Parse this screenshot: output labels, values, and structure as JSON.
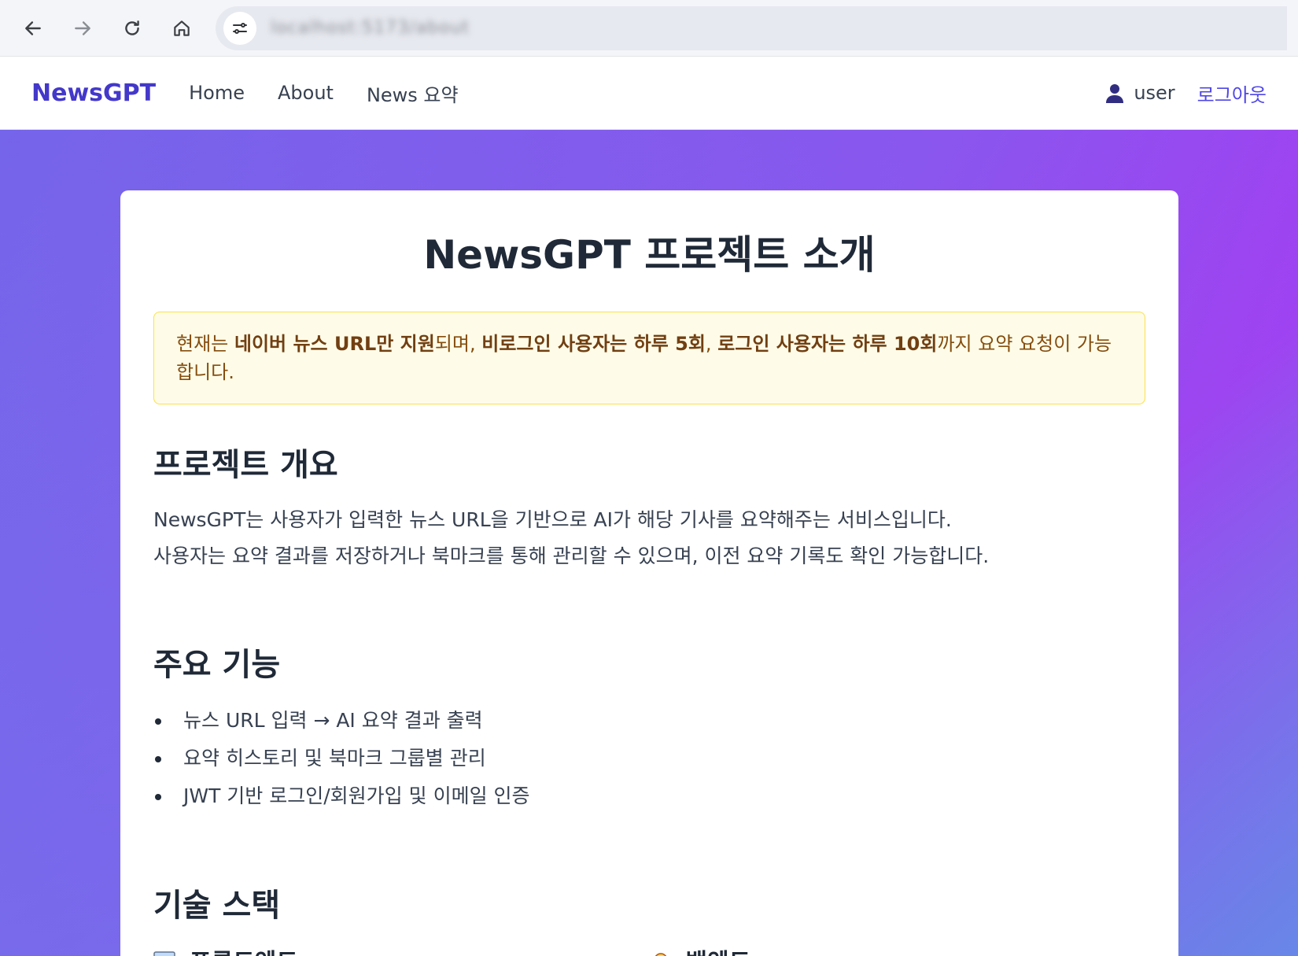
{
  "browser": {
    "url": "localhost:5173/about"
  },
  "nav": {
    "brand": "NewsGPT",
    "links": [
      "Home",
      "About",
      "News 요약"
    ],
    "username": "user",
    "logout": "로그아웃"
  },
  "page": {
    "title": "NewsGPT 프로젝트 소개",
    "notice": {
      "t1": "현재는 ",
      "b1": "네이버 뉴스 URL만 지원",
      "t2": "되며, ",
      "b2": "비로그인 사용자는 하루 5회",
      "t3": ", ",
      "b3": "로그인 사용자는 하루 10회",
      "t4": "까지 요약 요청이 가능합니다."
    },
    "overview_title": "프로젝트 개요",
    "overview_line1": "NewsGPT는 사용자가 입력한 뉴스 URL을 기반으로 AI가 해당 기사를 요약해주는 서비스입니다.",
    "overview_line2": "사용자는 요약 결과를 저장하거나 북마크를 통해 관리할 수 있으며, 이전 요약 기록도 확인 가능합니다.",
    "features_title": "주요 기능",
    "features": [
      "뉴스 URL 입력 → AI 요약 결과 출력",
      "요약 히스토리 및 북마크 그룹별 관리",
      "JWT 기반 로그인/회원가입 및 이메일 인증"
    ],
    "stack_title": "기술 스택",
    "stack_frontend": "프론트엔드",
    "stack_backend": "백엔드"
  }
}
